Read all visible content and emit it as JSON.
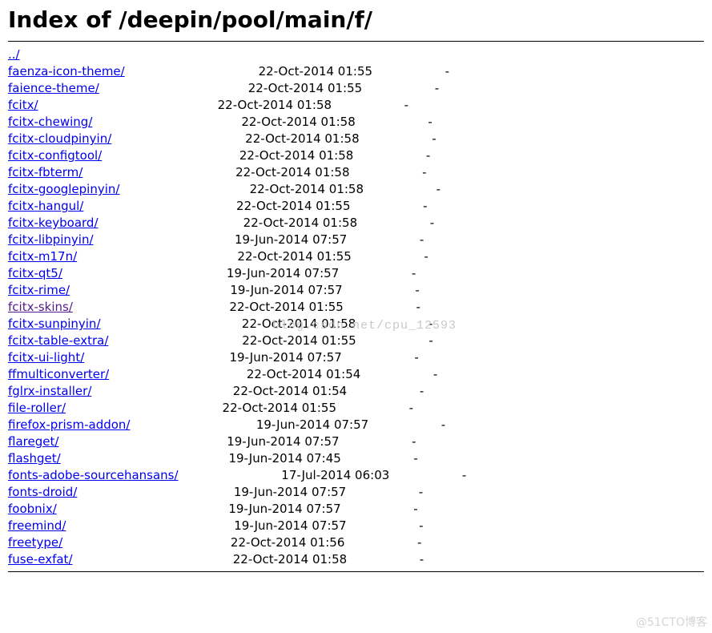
{
  "title": "Index of /deepin/pool/main/f/",
  "parent_link": "../",
  "col_width_name": 50,
  "col_width_date": 20,
  "entries": [
    {
      "name": "faenza-icon-theme/",
      "date": "22-Oct-2014 01:55",
      "size": "-",
      "visited": false
    },
    {
      "name": "faience-theme/",
      "date": "22-Oct-2014 01:55",
      "size": "-",
      "visited": false
    },
    {
      "name": "fcitx/",
      "date": "22-Oct-2014 01:58",
      "size": "-",
      "visited": false
    },
    {
      "name": "fcitx-chewing/",
      "date": "22-Oct-2014 01:58",
      "size": "-",
      "visited": false
    },
    {
      "name": "fcitx-cloudpinyin/",
      "date": "22-Oct-2014 01:58",
      "size": "-",
      "visited": false
    },
    {
      "name": "fcitx-configtool/",
      "date": "22-Oct-2014 01:58",
      "size": "-",
      "visited": false
    },
    {
      "name": "fcitx-fbterm/",
      "date": "22-Oct-2014 01:58",
      "size": "-",
      "visited": false
    },
    {
      "name": "fcitx-googlepinyin/",
      "date": "22-Oct-2014 01:58",
      "size": "-",
      "visited": false
    },
    {
      "name": "fcitx-hangul/",
      "date": "22-Oct-2014 01:55",
      "size": "-",
      "visited": false
    },
    {
      "name": "fcitx-keyboard/",
      "date": "22-Oct-2014 01:58",
      "size": "-",
      "visited": false
    },
    {
      "name": "fcitx-libpinyin/",
      "date": "19-Jun-2014 07:57",
      "size": "-",
      "visited": false
    },
    {
      "name": "fcitx-m17n/",
      "date": "22-Oct-2014 01:55",
      "size": "-",
      "visited": false
    },
    {
      "name": "fcitx-qt5/",
      "date": "19-Jun-2014 07:57",
      "size": "-",
      "visited": false
    },
    {
      "name": "fcitx-rime/",
      "date": "19-Jun-2014 07:57",
      "size": "-",
      "visited": false
    },
    {
      "name": "fcitx-skins/",
      "date": "22-Oct-2014 01:55",
      "size": "-",
      "visited": true
    },
    {
      "name": "fcitx-sunpinyin/",
      "date": "22-Oct-2014 01:58",
      "size": "-",
      "visited": false
    },
    {
      "name": "fcitx-table-extra/",
      "date": "22-Oct-2014 01:55",
      "size": "-",
      "visited": false
    },
    {
      "name": "fcitx-ui-light/",
      "date": "19-Jun-2014 07:57",
      "size": "-",
      "visited": false
    },
    {
      "name": "ffmulticonverter/",
      "date": "22-Oct-2014 01:54",
      "size": "-",
      "visited": false
    },
    {
      "name": "fglrx-installer/",
      "date": "22-Oct-2014 01:54",
      "size": "-",
      "visited": false
    },
    {
      "name": "file-roller/",
      "date": "22-Oct-2014 01:55",
      "size": "-",
      "visited": false
    },
    {
      "name": "firefox-prism-addon/",
      "date": "19-Jun-2014 07:57",
      "size": "-",
      "visited": false
    },
    {
      "name": "flareget/",
      "date": "19-Jun-2014 07:57",
      "size": "-",
      "visited": false
    },
    {
      "name": "flashget/",
      "date": "19-Jun-2014 07:45",
      "size": "-",
      "visited": false
    },
    {
      "name": "fonts-adobe-sourcehansans/",
      "date": "17-Jul-2014 06:03",
      "size": "-",
      "visited": false
    },
    {
      "name": "fonts-droid/",
      "date": "19-Jun-2014 07:57",
      "size": "-",
      "visited": false
    },
    {
      "name": "foobnix/",
      "date": "19-Jun-2014 07:57",
      "size": "-",
      "visited": false
    },
    {
      "name": "freemind/",
      "date": "19-Jun-2014 07:57",
      "size": "-",
      "visited": false
    },
    {
      "name": "freetype/",
      "date": "22-Oct-2014 01:56",
      "size": "-",
      "visited": false
    },
    {
      "name": "fuse-exfat/",
      "date": "22-Oct-2014 01:58",
      "size": "-",
      "visited": false
    }
  ],
  "watermarks": {
    "center": "blog.csdn.net/cpu_12593",
    "corner": "@51CTO博客"
  }
}
